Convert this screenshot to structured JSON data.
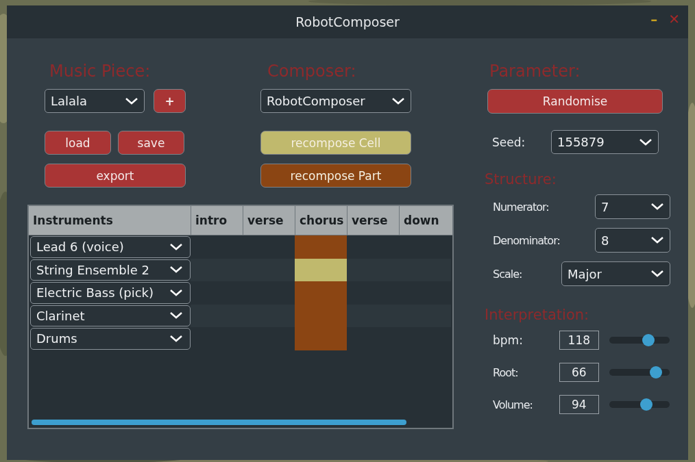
{
  "window": {
    "title": "RobotComposer",
    "controls": [
      "–",
      "✕"
    ]
  },
  "music_piece": {
    "heading": "Music Piece:",
    "piece": "Lalala",
    "add": "+",
    "buttons": [
      "load",
      "save"
    ],
    "export": "export"
  },
  "composer": {
    "heading": "Composer:",
    "value": "RobotComposer",
    "buttons": [
      {
        "label": "recompose Cell",
        "kind": "cell"
      },
      {
        "label": "recompose Part",
        "kind": "part"
      }
    ]
  },
  "table": {
    "columns": [
      "Instruments",
      "intro",
      "verse",
      "chorus",
      "verse",
      "down"
    ],
    "rows": [
      {
        "instrument": "Lead 6 (voice)",
        "cells": [
          {
            "kind": "empty"
          },
          {
            "kind": "empty"
          },
          {
            "kind": "part"
          },
          {
            "kind": "empty"
          },
          {
            "kind": "empty"
          }
        ]
      },
      {
        "instrument": "String Ensemble 2",
        "cells": [
          {
            "kind": "empty"
          },
          {
            "kind": "empty"
          },
          {
            "kind": "cell"
          },
          {
            "kind": "empty"
          },
          {
            "kind": "empty"
          }
        ]
      },
      {
        "instrument": "Electric Bass (pick)",
        "cells": [
          {
            "kind": "empty"
          },
          {
            "kind": "empty"
          },
          {
            "kind": "part"
          },
          {
            "kind": "empty"
          },
          {
            "kind": "empty"
          }
        ]
      },
      {
        "instrument": "Clarinet",
        "cells": [
          {
            "kind": "empty"
          },
          {
            "kind": "empty"
          },
          {
            "kind": "part"
          },
          {
            "kind": "empty"
          },
          {
            "kind": "empty"
          }
        ]
      },
      {
        "instrument": "Drums",
        "cells": [
          {
            "kind": "empty"
          },
          {
            "kind": "empty"
          },
          {
            "kind": "part"
          },
          {
            "kind": "empty"
          },
          {
            "kind": "empty"
          }
        ]
      }
    ]
  },
  "parameter": {
    "heading": "Parameter:",
    "randomise": "Randomise",
    "seed_label": "Seed:",
    "seed": "155879"
  },
  "structure": {
    "heading": "Structure:",
    "fields": [
      {
        "label": "Numerator:",
        "value": "7",
        "kind": "short"
      },
      {
        "label": "Denominator:",
        "value": "8",
        "kind": "short"
      },
      {
        "label": "Scale:",
        "value": "Major",
        "kind": "wide"
      }
    ]
  },
  "interpretation": {
    "heading": "Interpretation:",
    "sliders": [
      {
        "label": "bpm:",
        "value": "118",
        "level": 0.65
      },
      {
        "label": "Root:",
        "value": "66",
        "level": 0.77
      },
      {
        "label": "Volume:",
        "value": "94",
        "level": 0.61
      }
    ]
  }
}
